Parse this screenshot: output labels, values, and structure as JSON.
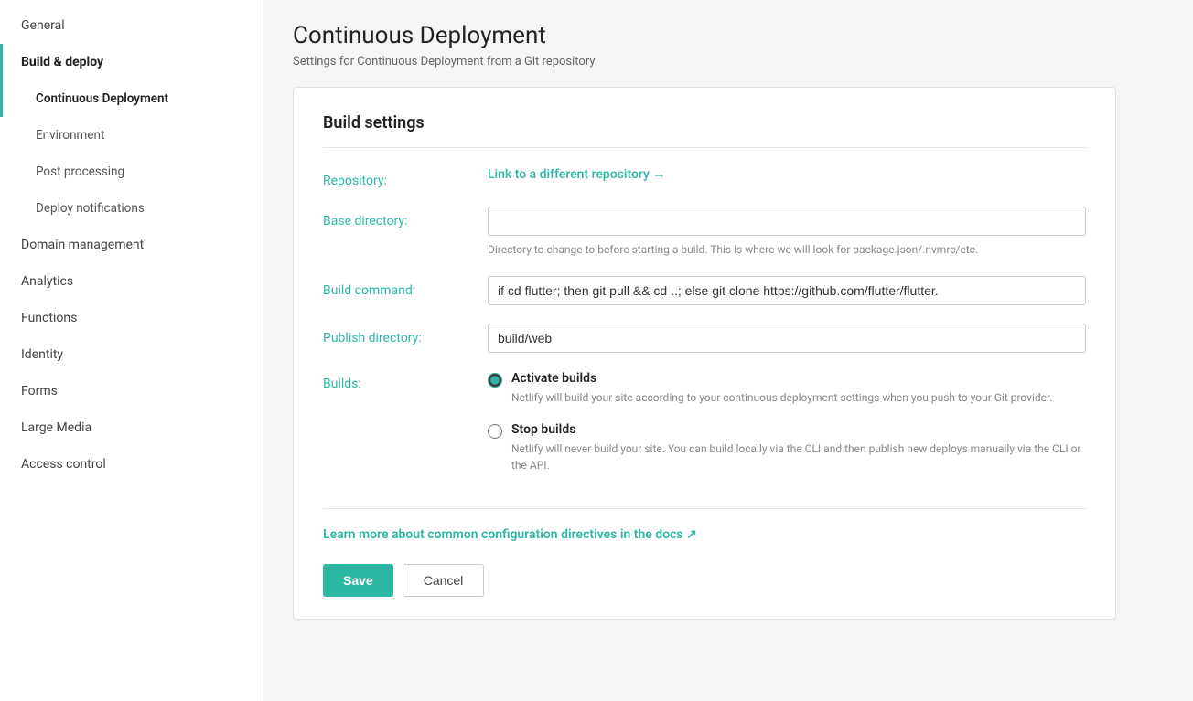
{
  "sidebar": {
    "items": [
      {
        "id": "general",
        "label": "General",
        "active": false,
        "sub": false
      },
      {
        "id": "build-deploy",
        "label": "Build & deploy",
        "active": true,
        "sub": false
      },
      {
        "id": "continuous-deployment",
        "label": "Continuous Deployment",
        "active": true,
        "sub": true
      },
      {
        "id": "environment",
        "label": "Environment",
        "active": false,
        "sub": true
      },
      {
        "id": "post-processing",
        "label": "Post processing",
        "active": false,
        "sub": true
      },
      {
        "id": "deploy-notifications",
        "label": "Deploy notifications",
        "active": false,
        "sub": true
      },
      {
        "id": "domain-management",
        "label": "Domain management",
        "active": false,
        "sub": false
      },
      {
        "id": "analytics",
        "label": "Analytics",
        "active": false,
        "sub": false
      },
      {
        "id": "functions",
        "label": "Functions",
        "active": false,
        "sub": false
      },
      {
        "id": "identity",
        "label": "Identity",
        "active": false,
        "sub": false
      },
      {
        "id": "forms",
        "label": "Forms",
        "active": false,
        "sub": false
      },
      {
        "id": "large-media",
        "label": "Large Media",
        "active": false,
        "sub": false
      },
      {
        "id": "access-control",
        "label": "Access control",
        "active": false,
        "sub": false
      }
    ]
  },
  "page": {
    "title": "Continuous Deployment",
    "subtitle": "Settings for Continuous Deployment from a Git repository"
  },
  "card": {
    "section_title": "Build settings",
    "repository_label": "Repository:",
    "repository_link": "Link to a different repository →",
    "base_directory_label": "Base directory:",
    "base_directory_value": "",
    "base_directory_placeholder": "",
    "base_directory_hint": "Directory to change to before starting a build. This is where we will look for package.json/.nvmrc/etc.",
    "build_command_label": "Build command:",
    "build_command_value": "if cd flutter; then git pull && cd ..; else git clone https://github.com/flutter/flutter.",
    "publish_directory_label": "Publish directory:",
    "publish_directory_value": "build/web",
    "builds_label": "Builds:",
    "activate_builds_label": "Activate builds",
    "activate_builds_desc": "Netlify will build your site according to your continuous deployment settings when you push to your Git provider.",
    "stop_builds_label": "Stop builds",
    "stop_builds_desc": "Netlify will never build your site. You can build locally via the CLI and then publish new deploys manually via the CLI or the API.",
    "docs_link": "Learn more about common configuration directives in the docs ↗",
    "save_button": "Save",
    "cancel_button": "Cancel"
  },
  "colors": {
    "accent": "#2db8a5"
  }
}
